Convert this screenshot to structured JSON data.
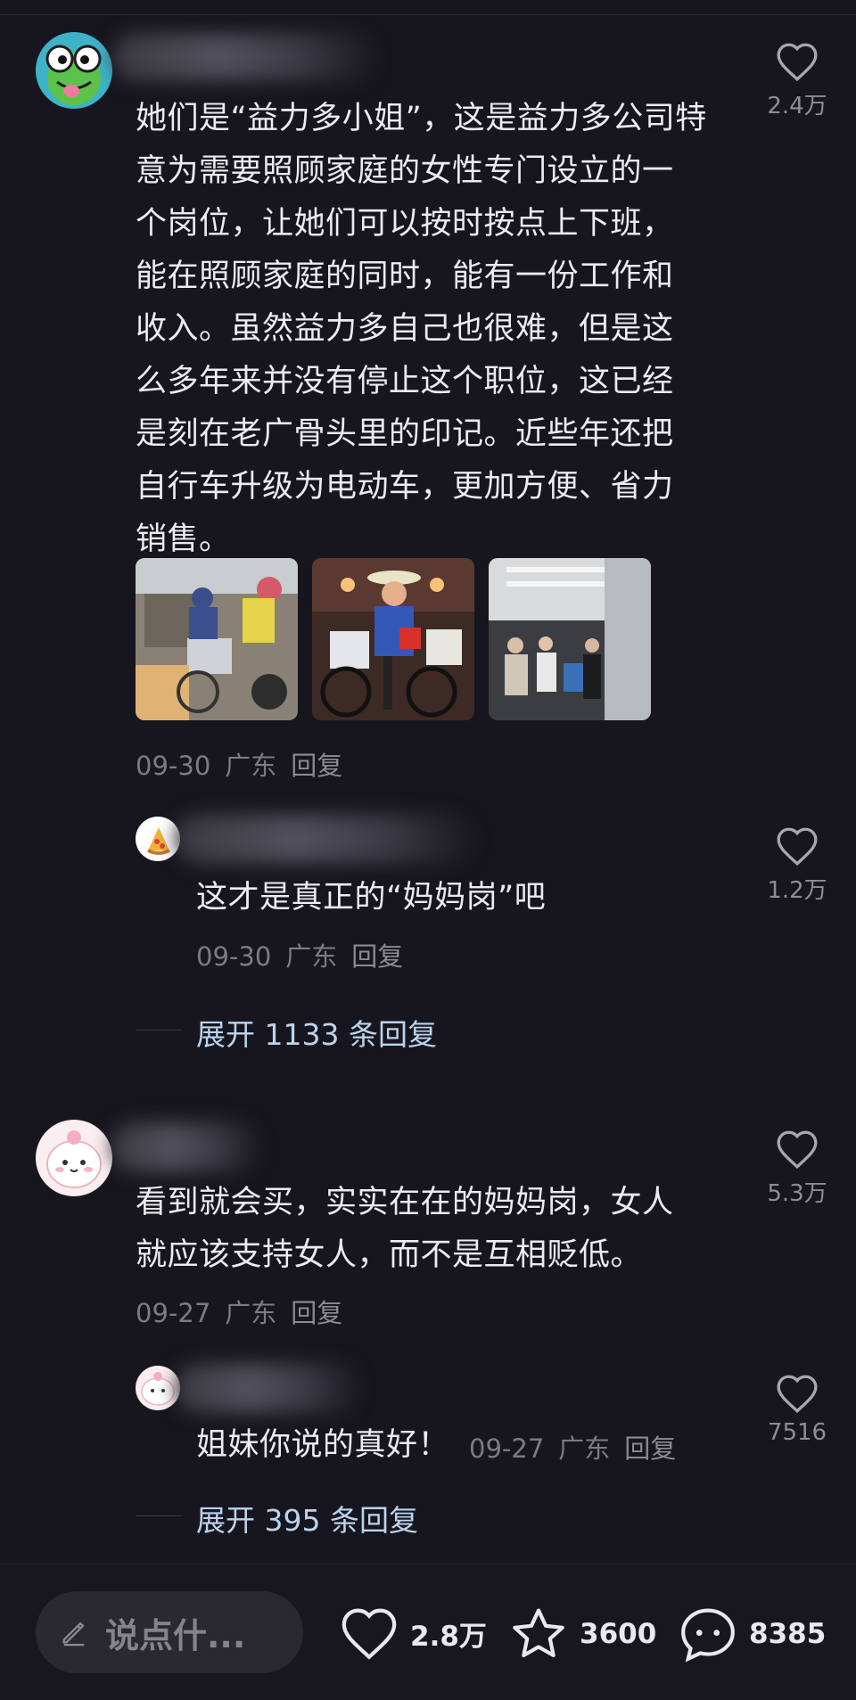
{
  "comments": [
    {
      "text": "她们是“益力多小姐”，这是益力多公司特\n意为需要照顾家庭的女性专门设立的一\n个岗位，让她们可以按时按点上下班，\n能在照顾家庭的同时，能有一份工作和\n收入。虽然益力多自己也很难，但是这\n么多年来并没有停止这个职位，这已经\n是刻在老广骨头里的印记。近些年还把\n自行车升级为电动车，更加方便、省力\n销售。",
      "date": "09-30",
      "location": "广东",
      "reply_label": "回复",
      "likes": "2.4万",
      "reply": {
        "text": "这才是真正的“妈妈岗”吧",
        "date": "09-30",
        "location": "广东",
        "reply_label": "回复",
        "likes": "1.2万"
      },
      "expand": "展开 1133 条回复"
    },
    {
      "text": "看到就会买，实实在在的妈妈岗，女人\n就应该支持女人，而不是互相贬低。",
      "date": "09-27",
      "location": "广东",
      "reply_label": "回复",
      "likes": "5.3万",
      "reply": {
        "text": "姐妹你说的真好！",
        "date": "09-27",
        "location": "广东",
        "reply_label": "回复",
        "likes": "7516"
      },
      "expand": "展开 395 条回复"
    }
  ],
  "bottom_bar": {
    "input_placeholder": "说点什...",
    "likes": "2.8万",
    "favorites": "3600",
    "comments": "8385"
  },
  "icons": {
    "like": "heart-icon",
    "favorite": "star-icon",
    "comment": "chat-bubble-icon",
    "edit": "pencil-icon"
  },
  "colors": {
    "background": "#17161e",
    "link": "#bcd3ee",
    "muted": "#7c7b85"
  }
}
